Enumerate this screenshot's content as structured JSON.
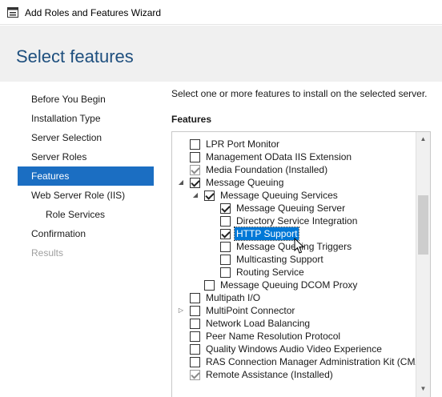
{
  "window": {
    "title": "Add Roles and Features Wizard"
  },
  "page": {
    "title": "Select features"
  },
  "nav": {
    "items": [
      {
        "label": "Before You Begin",
        "state": "normal",
        "indent": 0
      },
      {
        "label": "Installation Type",
        "state": "normal",
        "indent": 0
      },
      {
        "label": "Server Selection",
        "state": "normal",
        "indent": 0
      },
      {
        "label": "Server Roles",
        "state": "normal",
        "indent": 0
      },
      {
        "label": "Features",
        "state": "active",
        "indent": 0
      },
      {
        "label": "Web Server Role (IIS)",
        "state": "normal",
        "indent": 0
      },
      {
        "label": "Role Services",
        "state": "normal",
        "indent": 1
      },
      {
        "label": "Confirmation",
        "state": "normal",
        "indent": 0
      },
      {
        "label": "Results",
        "state": "disabled",
        "indent": 0
      }
    ]
  },
  "content": {
    "description": "Select one or more features to install on the selected server.",
    "features_label": "Features"
  },
  "features": [
    {
      "label": "LPR Port Monitor",
      "checked": false,
      "grey": false,
      "level": 0,
      "expander": ""
    },
    {
      "label": "Management OData IIS Extension",
      "checked": false,
      "grey": false,
      "level": 0,
      "expander": ""
    },
    {
      "label": "Media Foundation (Installed)",
      "checked": true,
      "grey": true,
      "level": 0,
      "expander": ""
    },
    {
      "label": "Message Queuing",
      "checked": true,
      "grey": false,
      "level": 0,
      "expander": "expanded"
    },
    {
      "label": "Message Queuing Services",
      "checked": true,
      "grey": false,
      "level": 1,
      "expander": "expanded"
    },
    {
      "label": "Message Queuing Server",
      "checked": true,
      "grey": false,
      "level": 2,
      "expander": ""
    },
    {
      "label": "Directory Service Integration",
      "checked": false,
      "grey": false,
      "level": 2,
      "expander": ""
    },
    {
      "label": "HTTP Support",
      "checked": true,
      "grey": false,
      "level": 2,
      "expander": "",
      "selected": true
    },
    {
      "label": "Message Queuing Triggers",
      "checked": false,
      "grey": false,
      "level": 2,
      "expander": ""
    },
    {
      "label": "Multicasting Support",
      "checked": false,
      "grey": false,
      "level": 2,
      "expander": ""
    },
    {
      "label": "Routing Service",
      "checked": false,
      "grey": false,
      "level": 2,
      "expander": ""
    },
    {
      "label": "Message Queuing DCOM Proxy",
      "checked": false,
      "grey": false,
      "level": 1,
      "expander": ""
    },
    {
      "label": "Multipath I/O",
      "checked": false,
      "grey": false,
      "level": 0,
      "expander": ""
    },
    {
      "label": "MultiPoint Connector",
      "checked": false,
      "grey": false,
      "level": 0,
      "expander": "collapsed"
    },
    {
      "label": "Network Load Balancing",
      "checked": false,
      "grey": false,
      "level": 0,
      "expander": ""
    },
    {
      "label": "Peer Name Resolution Protocol",
      "checked": false,
      "grey": false,
      "level": 0,
      "expander": ""
    },
    {
      "label": "Quality Windows Audio Video Experience",
      "checked": false,
      "grey": false,
      "level": 0,
      "expander": ""
    },
    {
      "label": "RAS Connection Manager Administration Kit (CMA",
      "checked": false,
      "grey": false,
      "level": 0,
      "expander": ""
    },
    {
      "label": "Remote Assistance (Installed)",
      "checked": true,
      "grey": true,
      "level": 0,
      "expander": ""
    }
  ],
  "scrollbar": {
    "position": 0.28
  }
}
